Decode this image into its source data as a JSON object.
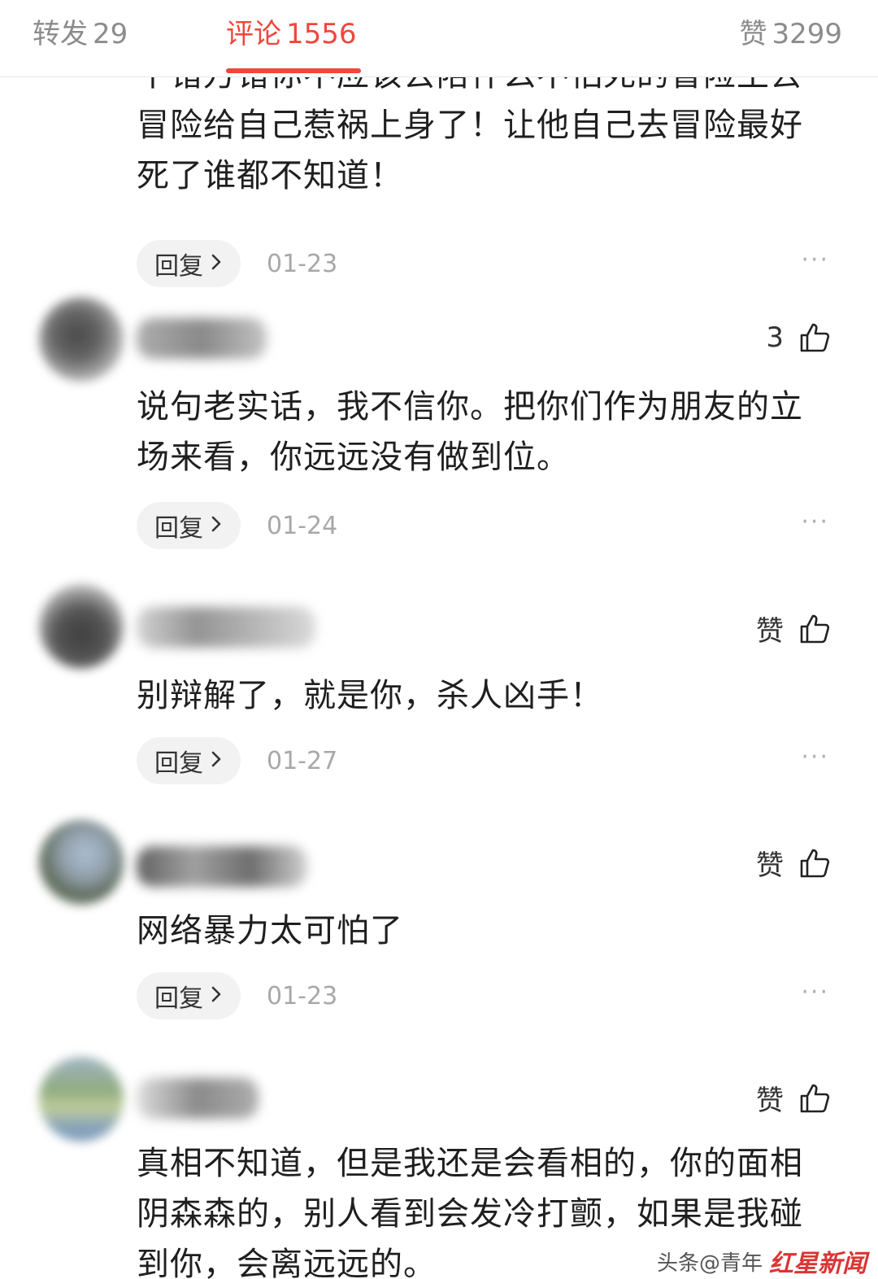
{
  "tabs": {
    "repost": {
      "label": "转发",
      "count": "29"
    },
    "comments": {
      "label": "评论",
      "count": "1556"
    },
    "likes": {
      "label": "赞",
      "count": "3299"
    }
  },
  "comments": [
    {
      "text": "千错万错你不应该去陪什么不怕死的冒险王去冒险给自己惹祸上身了！让他自己去冒险最好死了谁都不知道！",
      "reply_label": "回复",
      "date": "01-23"
    },
    {
      "like_label": "3",
      "text": "说句老实话，我不信你。把你们作为朋友的立场来看，你远远没有做到位。",
      "reply_label": "回复",
      "date": "01-24"
    },
    {
      "like_label": "赞",
      "text": "别辩解了，就是你，杀人凶手！",
      "reply_label": "回复",
      "date": "01-27"
    },
    {
      "like_label": "赞",
      "text": "网络暴力太可怕了",
      "reply_label": "回复",
      "date": "01-23"
    },
    {
      "like_label": "赞",
      "text": "真相不知道，但是我还是会看相的，你的面相阴森森的，别人看到会发冷打颤，如果是我碰到你，会离远远的。"
    }
  ],
  "more_glyph": "···",
  "watermark": {
    "text": "头条@青年",
    "logo": "红星新闻"
  },
  "colors": {
    "accent": "#f0463c",
    "muted": "#8c8c8c",
    "reply_bg": "#f2f2f2"
  }
}
